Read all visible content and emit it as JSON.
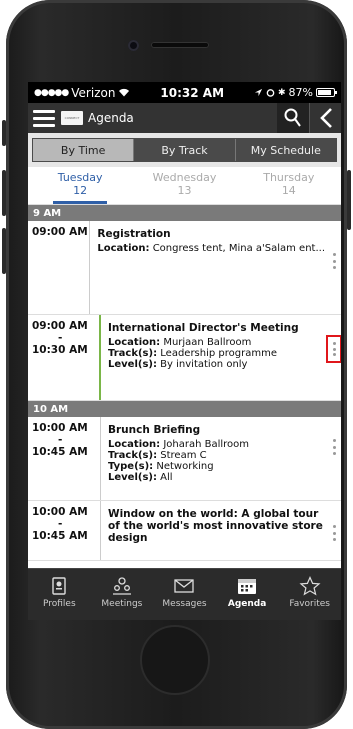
{
  "status_bar": {
    "carrier": "Verizon",
    "time": "10:32 AM",
    "battery": "87%",
    "battery_level": 0.87
  },
  "app_bar": {
    "title": "Agenda",
    "logo_text": "CONNECT"
  },
  "segments": [
    {
      "label": "By Time",
      "active": true
    },
    {
      "label": "By Track",
      "active": false
    },
    {
      "label": "My Schedule",
      "active": false
    }
  ],
  "days": [
    {
      "name": "Tuesday",
      "date": "12",
      "active": true
    },
    {
      "name": "Wednesday",
      "date": "13",
      "active": false
    },
    {
      "name": "Thursday",
      "date": "14",
      "active": false
    }
  ],
  "hours": [
    {
      "label": "9 AM",
      "sessions": [
        {
          "start": "09:00 AM",
          "end": "",
          "title": "Registration",
          "location": "Congress tent, Mina a'Salam ent...",
          "track": "",
          "type": "",
          "level": ""
        },
        {
          "start": "09:00 AM",
          "end": "10:30 AM",
          "title": "International Director's Meeting",
          "location": "Murjaan Ballroom",
          "track": "Leadership programme",
          "type": "",
          "level": "By invitation only"
        }
      ]
    },
    {
      "label": "10 AM",
      "sessions": [
        {
          "start": "10:00 AM",
          "end": "10:45 AM",
          "title": "Brunch Briefing",
          "location": "Joharah Ballroom",
          "track": "Stream C",
          "type": "Networking",
          "level": "All"
        },
        {
          "start": "10:00 AM",
          "end": "10:45 AM",
          "title": "Window on the world: A global tour of the world's most innovative store design",
          "location": "",
          "track": "",
          "type": "",
          "level": ""
        }
      ]
    }
  ],
  "field_labels": {
    "location": "Location:",
    "track": "Track(s):",
    "type": "Type(s):",
    "level": "Level(s):",
    "dash": "-"
  },
  "tabs": [
    {
      "label": "Profiles",
      "icon": "profile-card-icon",
      "active": false
    },
    {
      "label": "Meetings",
      "icon": "meetings-icon",
      "active": false
    },
    {
      "label": "Messages",
      "icon": "envelope-icon",
      "active": false
    },
    {
      "label": "Agenda",
      "icon": "calendar-icon",
      "active": true
    },
    {
      "label": "Favorites",
      "icon": "star-icon",
      "active": false
    }
  ]
}
